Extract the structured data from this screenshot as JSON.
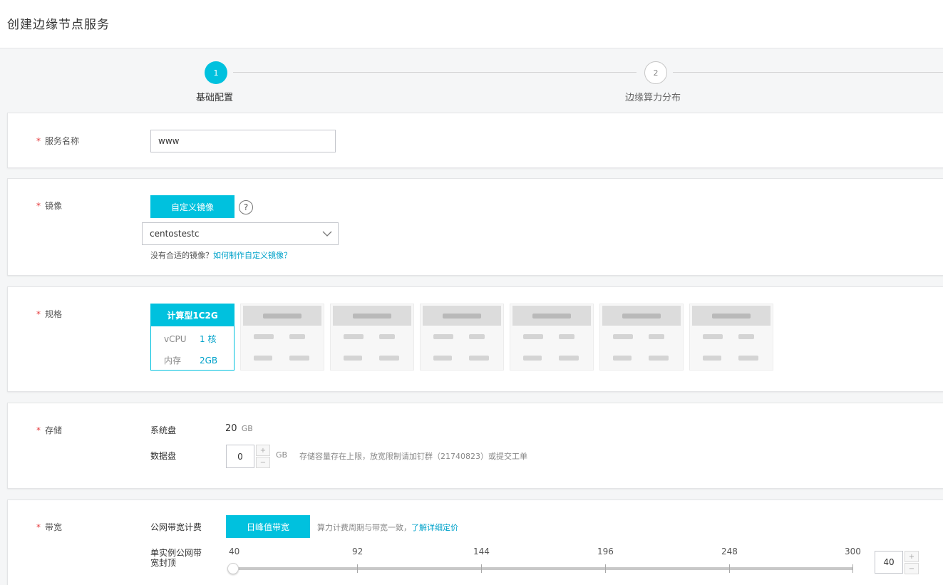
{
  "page": {
    "title": "创建边缘节点服务"
  },
  "steps": [
    {
      "number": "1",
      "label": "基础配置"
    },
    {
      "number": "2",
      "label": "边缘算力分布"
    }
  ],
  "service_name": {
    "label": "服务名称",
    "value": "www"
  },
  "image": {
    "label": "镜像",
    "tab_label": "自定义镜像",
    "help_glyph": "?",
    "selected": "centostestc",
    "hint_text": "没有合适的镜像？",
    "hint_link": "如何制作自定义镜像？"
  },
  "spec": {
    "label": "规格",
    "active": {
      "name": "计算型1C2G",
      "cpu_label": "vCPU",
      "cpu_value": "1 核",
      "mem_label": "内存",
      "mem_value": "2GB"
    }
  },
  "storage": {
    "label": "存储",
    "system_disk_label": "系统盘",
    "system_disk_value": "20",
    "unit": "GB",
    "data_disk_label": "数据盘",
    "data_disk_value": "0",
    "data_disk_unit": "GB",
    "note": "存储容量存在上限，放宽限制请加钉群（21740823）或提交工单",
    "plus": "+",
    "minus": "−"
  },
  "bandwidth": {
    "label": "带宽",
    "billing_label": "公网带宽计费",
    "billing_button": "日峰值带宽",
    "billing_note": "算力计费周期与带宽一致，",
    "billing_link": "了解详细定价",
    "cap_label_line1": "单实例公网带",
    "cap_label_line2": "宽封顶",
    "ticks": [
      "40",
      "92",
      "144",
      "196",
      "248",
      "300"
    ],
    "value": "40",
    "plus": "+",
    "minus": "−"
  },
  "colors": {
    "accent": "#00c1de",
    "link": "#00a2ca",
    "required": "#e4393c"
  }
}
